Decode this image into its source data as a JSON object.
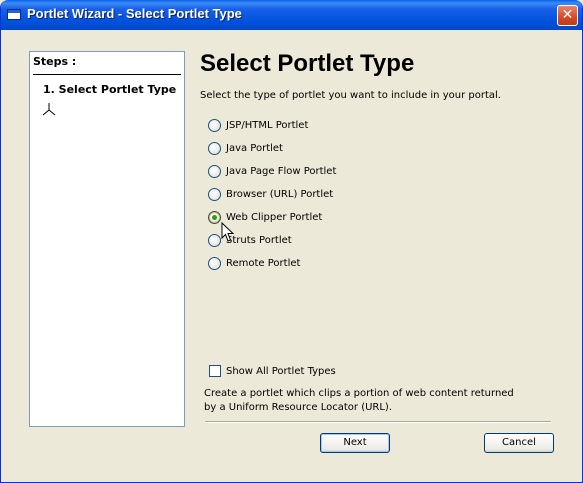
{
  "window": {
    "title": "Portlet Wizard - Select Portlet Type",
    "close_glyph": "✕"
  },
  "steps": {
    "title": "Steps :",
    "items": [
      {
        "label": "1. Select Portlet Type"
      }
    ]
  },
  "main": {
    "heading": "Select Portlet Type",
    "description": "Select the type of portlet you want to include in your portal.",
    "options": [
      {
        "label": "JSP/HTML Portlet",
        "checked": false
      },
      {
        "label": "Java Portlet",
        "checked": false
      },
      {
        "label": "Java Page Flow Portlet",
        "checked": false
      },
      {
        "label": "Browser (URL) Portlet",
        "checked": false
      },
      {
        "label": "Web Clipper Portlet",
        "checked": true
      },
      {
        "label": "Struts Portlet",
        "checked": false
      },
      {
        "label": "Remote Portlet",
        "checked": false
      }
    ],
    "show_all": {
      "label": "Show All Portlet Types",
      "checked": false
    },
    "info_line1": "Create a portlet which clips a portion of web content returned",
    "info_line2": "by a Uniform Resource Locator (URL)."
  },
  "buttons": {
    "next": "Next",
    "cancel": "Cancel"
  },
  "colors": {
    "titlebar": "#0052DD",
    "window_bg": "#ECE9D8",
    "radio_selected": "#21A121"
  }
}
